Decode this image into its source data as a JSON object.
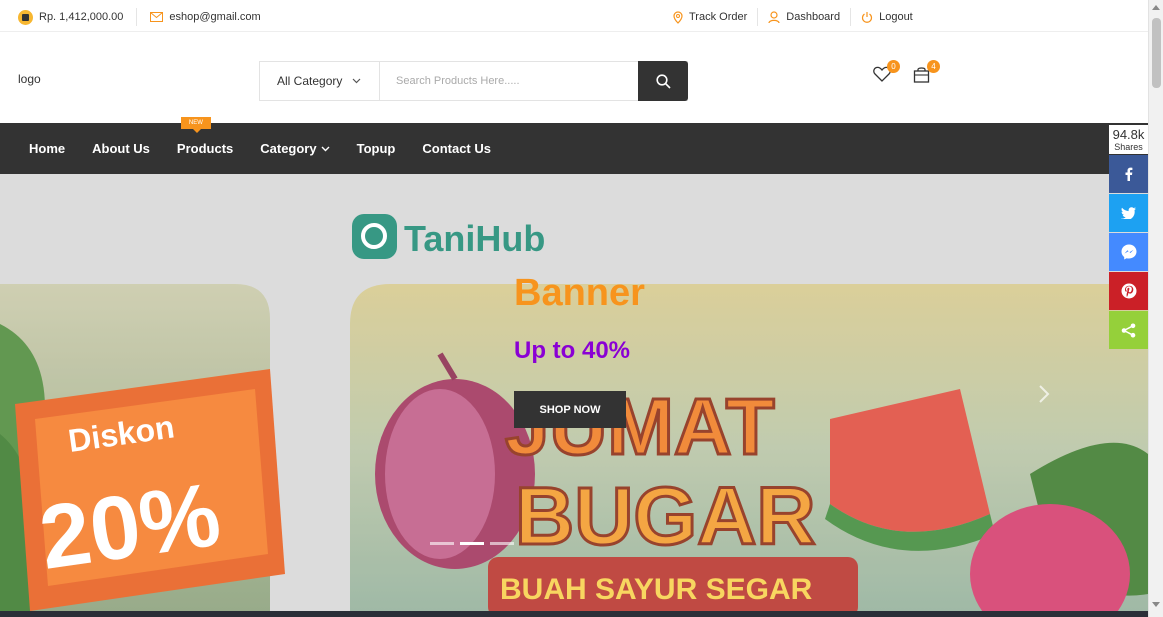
{
  "topbar": {
    "balance": "Rp. 1,412,000.00",
    "email": "eshop@gmail.com",
    "track_order": "Track Order",
    "dashboard": "Dashboard",
    "logout": "Logout"
  },
  "header": {
    "logo": "logo",
    "category_select": "All Category",
    "search_placeholder": "Search Products Here.....",
    "wishlist_count": "0",
    "cart_count": "4"
  },
  "nav": {
    "items": [
      {
        "label": "Home"
      },
      {
        "label": "About Us"
      },
      {
        "label": "Products",
        "tag": "NEW"
      },
      {
        "label": "Category"
      },
      {
        "label": "Topup"
      },
      {
        "label": "Contact Us"
      }
    ]
  },
  "hero": {
    "title": "Banner",
    "subtitle": "Up to 40%",
    "button": "SHOP NOW",
    "image_text": {
      "brand": "TaniHub",
      "discount_label": "Diskon",
      "discount_value": "20%",
      "headline_1": "JUMAT",
      "headline_2": "BUGAR",
      "tagline": "BUAH SAYUR SEGAR"
    },
    "slide_count": 3,
    "active_slide": 2
  },
  "share": {
    "count": "94.8k",
    "label": "Shares",
    "buttons": [
      {
        "name": "facebook",
        "color": "#3b5998"
      },
      {
        "name": "twitter",
        "color": "#1da1f2"
      },
      {
        "name": "messenger",
        "color": "#448aff"
      },
      {
        "name": "pinterest",
        "color": "#cb2027"
      },
      {
        "name": "sharethis",
        "color": "#95d03a"
      }
    ]
  },
  "colors": {
    "accent": "#F7941D",
    "dark": "#333333",
    "subtitle": "#8A00D4"
  }
}
